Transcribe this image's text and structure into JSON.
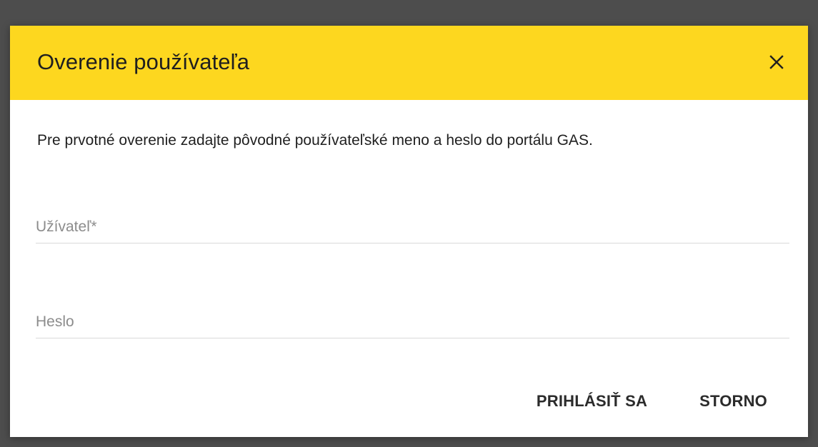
{
  "dialog": {
    "title": "Overenie používateľa",
    "close_icon": "close-icon",
    "instruction": "Pre prvotné overenie zadajte pôvodné používateľské meno a heslo do portálu GAS.",
    "username": {
      "placeholder": "Užívateľ*",
      "value": ""
    },
    "password": {
      "placeholder": "Heslo",
      "value": ""
    },
    "buttons": {
      "login_label": "PRIHLÁSIŤ SA",
      "cancel_label": "STORNO"
    }
  },
  "colors": {
    "header_background": "#fdd71f",
    "backdrop": "#4d4d4d",
    "dialog_background": "#ffffff",
    "text": "#1f1f1f",
    "placeholder": "#8c8c8c"
  }
}
